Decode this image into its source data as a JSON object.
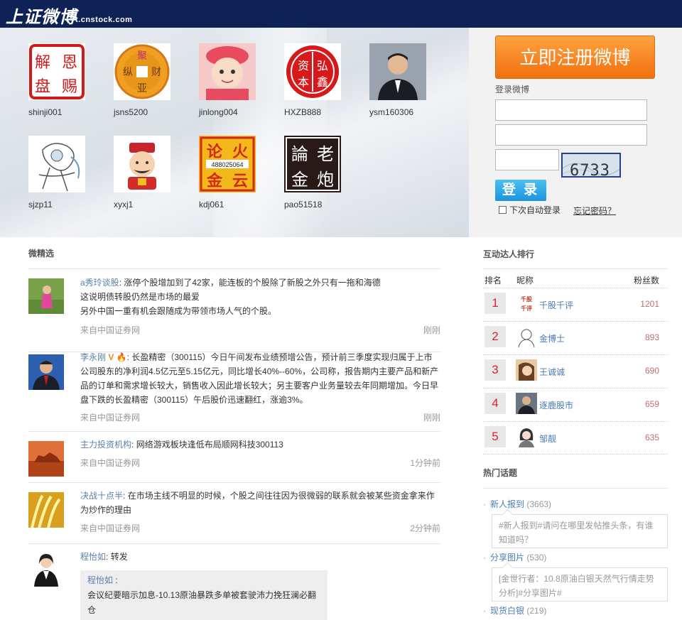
{
  "header": {
    "logo": "上证微博",
    "domain": "t.cnstock.com"
  },
  "users": [
    {
      "name": "shinji001",
      "glyphs": [
        "解",
        "恩",
        "盘",
        "赐"
      ]
    },
    {
      "name": "jsns5200",
      "glyphs": [
        "聚",
        "纵",
        "财",
        "亚"
      ]
    },
    {
      "name": "jinlong004"
    },
    {
      "name": "HXZB888",
      "glyphs": [
        "资",
        "弘",
        "本",
        "鑫"
      ]
    },
    {
      "name": "ysm160306"
    },
    {
      "name": "sjzp11"
    },
    {
      "name": "xyxj1"
    },
    {
      "name": "kdj061",
      "glyphs": [
        "论",
        "火",
        "金",
        "云"
      ],
      "number": "488025064"
    },
    {
      "name": "pao51518",
      "glyphs": [
        "論",
        "老",
        "金",
        "炮"
      ]
    }
  ],
  "login": {
    "register_label": "立即注册微博",
    "label": "登录微博",
    "captcha": "6733",
    "login_button": "登 录",
    "auto_login": "下次自动登录",
    "forgot": "忘记密码？"
  },
  "featured": {
    "title": "微精选",
    "items": [
      {
        "author": "a秀玲谈股",
        "sep": ":",
        "text": " 涨停个股增加到了42家，能连板的个股除了新股之外只有一拖和海德\n这说明债转股仍然是市场的最爱\n另外中国一重有机会跟随成为带领市场人气的个股。",
        "source": "来自中国证券网",
        "time": "刚刚"
      },
      {
        "author": "李永刚",
        "sep": ":",
        "text": " 长盈精密（300115）今日午间发布业绩预增公告，预计前三季度实现归属于上市公司股东的净利润4.5亿元至5.15亿元，同比增长40%--60%，公司称，报告期内主要产品和新产品的订单和需求增长较大，销售收入因此增长较大；另主要客户业务量较去年同期增加。今日早盘下跌的长盈精密（300115）午后股价迅速翻红，涨逾3%。",
        "source": "来自中国证券网",
        "time": "刚刚"
      },
      {
        "author": "主力投资机构",
        "sep": ":",
        "text": " 网络游戏板块逢低布局顺网科技300113",
        "source": "来自中国证券网",
        "time": "1分钟前"
      },
      {
        "author": "决战十点半",
        "sep": ":",
        "text": " 在市场主线不明显的时候，个股之间往往因为很微弱的联系就会被某些资金拿来作为炒作的理由",
        "source": "来自中国证券网",
        "time": "2分钟前"
      },
      {
        "author": "程怡如",
        "sep": ":",
        "text": " 转发",
        "quote_author": "程怡如",
        "quote_sep": " :",
        "quote_text": "会议纪要暗示加息-10.13原油暴跌多单被套驶沛力挽狂澜必翻仓"
      }
    ]
  },
  "ranking": {
    "title": "互动达人排行",
    "headers": {
      "rank": "排名",
      "nick": "昵称",
      "fans": "粉丝数"
    },
    "rows": [
      {
        "rank": "1",
        "name": "千股千评",
        "fans": "1201",
        "icon_text": [
          "千股",
          "千评"
        ]
      },
      {
        "rank": "2",
        "name": "金博士",
        "fans": "893"
      },
      {
        "rank": "3",
        "name": "王诚诚",
        "fans": "690"
      },
      {
        "rank": "4",
        "name": "逐鹿股市",
        "fans": "659"
      },
      {
        "rank": "5",
        "name": "邹靓",
        "fans": "635"
      }
    ]
  },
  "topics": {
    "title": "热门话题",
    "items": [
      {
        "label": "新人报到",
        "count": "(3663)",
        "preview": "#新人报到#请问在哪里发帖推头条，有谁知道吗？"
      },
      {
        "label": "分享图片",
        "count": "(530)",
        "preview": "[金世行者：10.8原油白银天然气行情走势分析]#分享图片#"
      },
      {
        "label": "现货白银",
        "count": "(219)"
      }
    ]
  },
  "colors": {
    "topbar": "#0f2255",
    "register": "#f5841f",
    "login": "#2aa3e8",
    "link": "#4a7bb5",
    "rank_number": "#dd2233"
  }
}
